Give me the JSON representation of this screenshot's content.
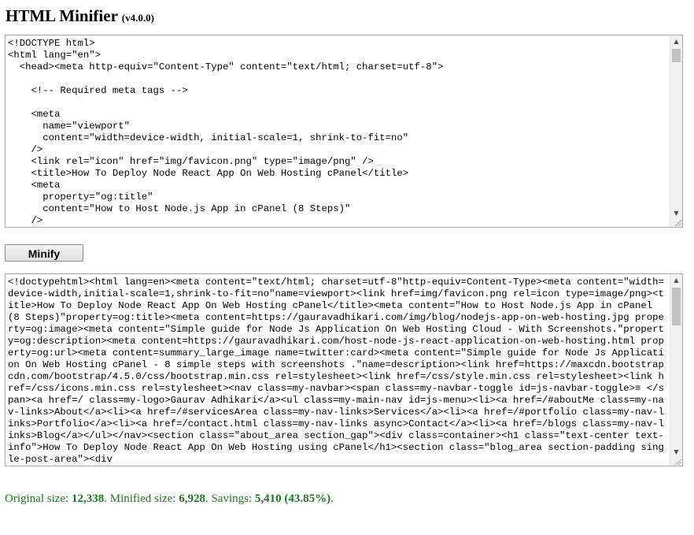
{
  "header": {
    "title": "HTML Minifier",
    "version": "(v4.0.0)"
  },
  "input": {
    "lines": [
      "<!DOCTYPE html>",
      "<html lang=\"en\">",
      "  <head><meta http-equiv=\"Content-Type\" content=\"text/html; charset=utf-8\">",
      "",
      "    <!-- Required meta tags -->",
      "",
      "    <meta",
      "      name=\"viewport\"",
      "      content=\"width=device-width, initial-scale=1, shrink-to-fit=no\"",
      "    />",
      "    <link rel=\"icon\" href=\"img/favicon.png\" type=\"image/png\" />",
      "    <title>How To Deploy Node React App On Web Hosting cPanel</title>",
      "    <meta",
      "      property=\"og:title\"",
      "      content=\"How to Host Node.js App in cPanel (8 Steps)\"",
      "    />"
    ]
  },
  "minify_button": {
    "label": "Minify"
  },
  "output": {
    "text": "<!doctypehtml><html lang=en><meta content=\"text/html; charset=utf-8\"http-equiv=Content-Type><meta content=\"width=device-width,initial-scale=1,shrink-to-fit=no\"name=viewport><link href=img/favicon.png rel=icon type=image/png><title>How To Deploy Node React App On Web Hosting cPanel</title><meta content=\"How to Host Node.js App in cPanel (8 Steps)\"property=og:title><meta content=https://gauravadhikari.com/img/blog/nodejs-app-on-web-hosting.jpg property=og:image><meta content=\"Simple guide for Node Js Application On Web Hosting Cloud - With Screenshots.\"property=og:description><meta content=https://gauravadhikari.com/host-node-js-react-application-on-web-hosting.html property=og:url><meta content=summary_large_image name=twitter:card><meta content=\"Simple guide for Node Js Application On Web Hosting cPanel - 8 simple steps with screenshots .\"name=description><link href=https://maxcdn.bootstrapcdn.com/bootstrap/4.5.0/css/bootstrap.min.css rel=stylesheet><link href=/css/style.min.css rel=stylesheet><link href=/css/icons.min.css rel=stylesheet><nav class=my-navbar><span class=my-navbar-toggle id=js-navbar-toggle>≡ </span><a href=/ class=my-logo>Gaurav Adhikari</a><ul class=my-main-nav id=js-menu><li><a href=/#aboutMe class=my-nav-links>About</a><li><a href=/#servicesArea class=my-nav-links>Services</a><li><a href=/#portfolio class=my-nav-links>Portfolio</a><li><a href=/contact.html class=my-nav-links async>Contact</a><li><a href=/blogs class=my-nav-links>Blog</a></ul></nav><section class=\"about_area section_gap\"><div class=container><h1 class=\"text-center text-info\">How To Deploy Node React App On Web Hosting using cPanel</h1><section class=\"blog_area section-padding single-post-area\"><div"
  },
  "stats": {
    "original_label": "Original size:",
    "original_value": "12,338",
    "minified_label": "Minified size:",
    "minified_value": "6,928",
    "savings_label": "Savings:",
    "savings_value": "5,410 (43.85%)"
  }
}
